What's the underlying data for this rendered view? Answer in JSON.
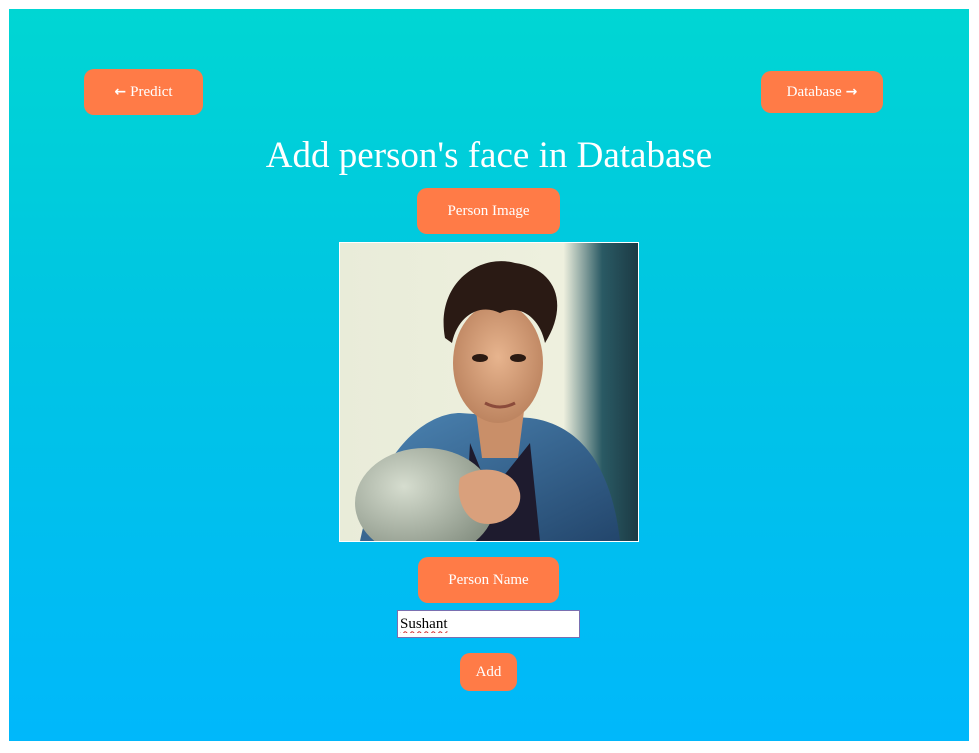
{
  "nav": {
    "predict_label": "Predict",
    "database_label": "Database",
    "predict_icon": "arrow-left-icon",
    "database_icon": "arrow-right-icon"
  },
  "page": {
    "title": "Add person's face in Database"
  },
  "form": {
    "person_image_label": "Person Image",
    "person_name_label": "Person Name",
    "name_value": "Sushant",
    "add_label": "Add"
  },
  "colors": {
    "accent": "#ff7b47",
    "background_top": "#00d6d3",
    "background_bottom": "#00b8fb",
    "text": "#ffffff"
  }
}
